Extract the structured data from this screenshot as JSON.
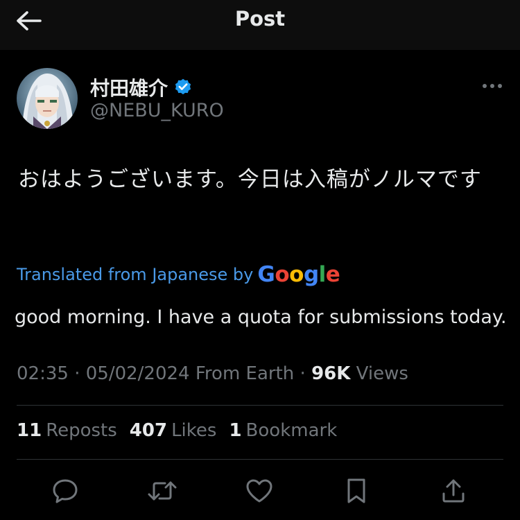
{
  "header": {
    "title": "Post",
    "back_icon": "arrow-left-icon"
  },
  "author": {
    "name": "村田雄介",
    "handle": "@NEBU_KURO",
    "verified": true,
    "verified_color": "#1d9bf0"
  },
  "tweet": {
    "text": "おはようございます。今日は入稿がノルマです",
    "translated_label": "Translated from Japanese by",
    "translation": "good morning. I have a quota for submissions today."
  },
  "meta": {
    "time": "02:35",
    "separator": " · ",
    "date": "05/02/2024",
    "location": "From Earth",
    "views_count": "96K",
    "views_label": "Views"
  },
  "stats": [
    {
      "count": "11",
      "label": "Reposts"
    },
    {
      "count": "407",
      "label": "Likes"
    },
    {
      "count": "1",
      "label": "Bookmark"
    }
  ],
  "actions": [
    {
      "icon": "reply-icon"
    },
    {
      "icon": "repost-icon"
    },
    {
      "icon": "like-heart-icon"
    },
    {
      "icon": "bookmark-icon"
    },
    {
      "icon": "share-icon"
    }
  ],
  "colors": {
    "background": "#000000",
    "header_bg": "#0d0d0d",
    "text_primary": "#e7e9ea",
    "text_secondary": "#71767b",
    "link_blue": "#4a9ae8",
    "divider": "#2f3336"
  }
}
